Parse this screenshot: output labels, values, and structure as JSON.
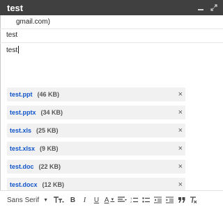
{
  "window": {
    "title": "test"
  },
  "compose": {
    "to_value": "gmail.com)",
    "subject_value": "test",
    "body_text": "test"
  },
  "attachments": [
    {
      "name": "test.ppt",
      "size": "(46 KB)"
    },
    {
      "name": "test.pptx",
      "size": "(34 KB)"
    },
    {
      "name": "test.xls",
      "size": "(25 KB)"
    },
    {
      "name": "test.xlsx",
      "size": "(9 KB)"
    },
    {
      "name": "test.doc",
      "size": "(22 KB)"
    },
    {
      "name": "test.docx",
      "size": "(12 KB)"
    }
  ],
  "toolbar": {
    "font_family": "Sans Serif",
    "bold_label": "B",
    "italic_label": "I",
    "underline_label": "U",
    "color_label": "A",
    "close_glyph": "×"
  },
  "icons": [
    "minimize-icon",
    "expand-icon",
    "close-icon",
    "text-size-icon",
    "align-icon",
    "numbered-list-icon",
    "bulleted-list-icon",
    "indent-less-icon",
    "indent-more-icon",
    "quote-icon",
    "remove-formatting-icon"
  ],
  "colors": {
    "titlebar": "#404040",
    "link": "#1155cc",
    "chip": "#f1f1f1"
  }
}
